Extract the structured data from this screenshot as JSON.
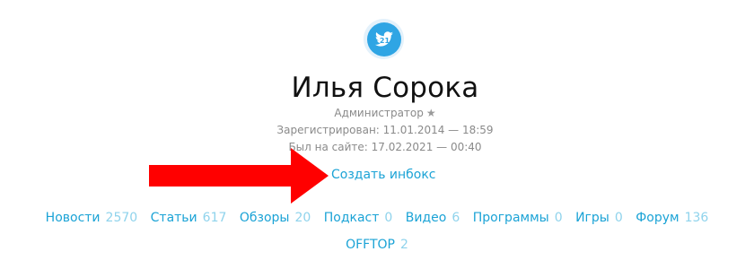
{
  "profile": {
    "name": "Илья Сорока",
    "avatar_badge": "21",
    "avatar_icon": "twitter-bird-icon",
    "role": "Администратор",
    "role_icon": "star-icon",
    "registered": "Зарегистрирован: 11.01.2014 — 18:59",
    "last_seen": "Был на сайте: 17.02.2021 — 00:40",
    "create_inbox_label": "Создать инбокс"
  },
  "annotation": {
    "arrow_icon": "red-arrow-icon",
    "arrow_color": "#ff0000"
  },
  "stats": [
    {
      "label": "Новости",
      "count": "2570"
    },
    {
      "label": "Статьи",
      "count": "617"
    },
    {
      "label": "Обзоры",
      "count": "20"
    },
    {
      "label": "Подкаст",
      "count": "0"
    },
    {
      "label": "Видео",
      "count": "6"
    },
    {
      "label": "Программы",
      "count": "0"
    },
    {
      "label": "Игры",
      "count": "0"
    },
    {
      "label": "Форум",
      "count": "136"
    },
    {
      "label": "OFFTOP",
      "count": "2"
    }
  ],
  "colors": {
    "link": "#1ba3d6",
    "count": "#8fd3ec",
    "meta": "#8a8a8a",
    "avatar": "#2fa5e4"
  }
}
